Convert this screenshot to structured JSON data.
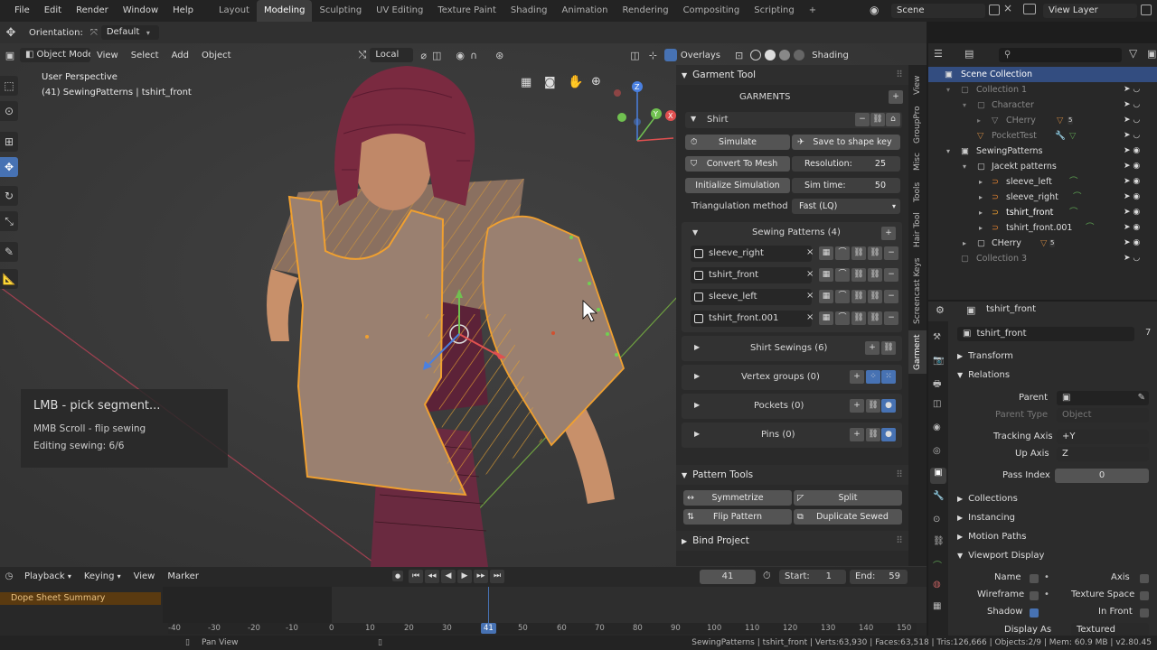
{
  "topbar": {
    "menus": [
      "File",
      "Edit",
      "Render",
      "Window",
      "Help"
    ],
    "workspaces": [
      "Layout",
      "Modeling",
      "Sculpting",
      "UV Editing",
      "Texture Paint",
      "Shading",
      "Animation",
      "Rendering",
      "Compositing",
      "Scripting"
    ],
    "active_workspace": "Modeling",
    "scene": "Scene",
    "view_layer": "View Layer"
  },
  "tool_settings": {
    "orientation_label": "Orientation:",
    "orientation_value": "Default"
  },
  "viewport": {
    "mode": "Object Mode",
    "menus": [
      "View",
      "Select",
      "Add",
      "Object"
    ],
    "transform_space": "Local",
    "overlays_label": "Overlays",
    "shading_label": "Shading",
    "view_name": "User Perspective",
    "object_info": "(41) SewingPatterns | tshirt_front",
    "hint_title": "LMB - pick segment...",
    "hint_line1": "MMB Scroll  - flip sewing",
    "hint_line2": "Editing sewing: 6/6",
    "gizmo_axes": {
      "x": "X",
      "y": "Y",
      "z": "Z"
    }
  },
  "garment_panel": {
    "title": "Garment Tool",
    "garments_label": "GARMENTS",
    "garment_name": "Shirt",
    "simulate": "Simulate",
    "save_shape_key": "Save to shape key",
    "convert_to_mesh": "Convert To Mesh",
    "resolution_label": "Resolution:",
    "resolution_value": "25",
    "init_sim": "Initialize Simulation",
    "sim_time_label": "Sim time:",
    "sim_time_value": "50",
    "triangulation_label": "Triangulation method",
    "triangulation_value": "Fast (LQ)",
    "sewing_patterns_title": "Sewing Patterns (4)",
    "patterns": [
      "sleeve_right",
      "tshirt_front",
      "sleeve_left",
      "tshirt_front.001"
    ],
    "shirt_sewings": "Shirt Sewings (6)",
    "vertex_groups": "Vertex groups (0)",
    "pockets": "Pockets (0)",
    "pins": "Pins (0)"
  },
  "pattern_tools": {
    "title": "Pattern Tools",
    "symmetrize": "Symmetrize",
    "split": "Split",
    "flip_pattern": "Flip Pattern",
    "duplicate_sewed": "Duplicate Sewed"
  },
  "bind_project": {
    "title": "Bind Project"
  },
  "side_tabs": [
    "View",
    "GroupPro",
    "Misc",
    "Tools",
    "Hair Tool",
    "Screencast Keys",
    "Garment"
  ],
  "active_side_tab": "Garment",
  "outliner": {
    "rows": [
      {
        "label": "Scene Collection",
        "indent": 0
      },
      {
        "label": "Collection 1",
        "indent": 1
      },
      {
        "label": "Character",
        "indent": 2
      },
      {
        "label": "CHerry",
        "indent": 3
      },
      {
        "label": "PocketTest",
        "indent": 2
      },
      {
        "label": "SewingPatterns",
        "indent": 1
      },
      {
        "label": "Jacekt patterns",
        "indent": 2
      },
      {
        "label": "sleeve_left",
        "indent": 3
      },
      {
        "label": "sleeve_right",
        "indent": 3
      },
      {
        "label": "tshirt_front",
        "indent": 3
      },
      {
        "label": "tshirt_front.001",
        "indent": 3
      },
      {
        "label": "CHerry",
        "indent": 2
      },
      {
        "label": "Collection 3",
        "indent": 1
      }
    ],
    "badge_5a": "5",
    "badge_5b": "5"
  },
  "properties": {
    "header_object": "tshirt_front",
    "object_name": "tshirt_front",
    "users_count": "7",
    "transform": "Transform",
    "relations": "Relations",
    "parent_label": "Parent",
    "parent_type_label": "Parent Type",
    "parent_type_value": "Object",
    "tracking_axis_label": "Tracking Axis",
    "tracking_axis_value": "+Y",
    "up_axis_label": "Up Axis",
    "up_axis_value": "Z",
    "pass_index_label": "Pass Index",
    "pass_index_value": "0",
    "collections": "Collections",
    "instancing": "Instancing",
    "motion_paths": "Motion Paths",
    "viewport_display": "Viewport Display",
    "name_label": "Name",
    "axis_label": "Axis",
    "wireframe_label": "Wireframe",
    "texture_space_label": "Texture Space",
    "shadow_label": "Shadow",
    "in_front_label": "In Front",
    "display_as_label": "Display As",
    "display_as_value": "Textured"
  },
  "timeline": {
    "menus": [
      "Playback",
      "Keying",
      "View",
      "Marker"
    ],
    "current_frame": "41",
    "start_label": "Start:",
    "start_value": "1",
    "end_label": "End:",
    "end_value": "59",
    "dope_sheet_summary": "Dope Sheet Summary",
    "ruler": [
      "-40",
      "-30",
      "-20",
      "-10",
      "0",
      "10",
      "20",
      "30",
      "41",
      "50",
      "60",
      "70",
      "80",
      "90",
      "100",
      "110",
      "120",
      "130",
      "140",
      "150"
    ]
  },
  "statusbar": {
    "left": "Pan View",
    "right": "SewingPatterns | tshirt_front | Verts:63,930 | Faces:63,518 | Tris:126,666 | Objects:2/9 | Mem: 60.9 MB | v2.80.45"
  },
  "colors": {
    "accent": "#4772b3",
    "selection_orange": "#f0a030",
    "garment_fill": "#9a8070",
    "hair": "#7a2a40"
  }
}
